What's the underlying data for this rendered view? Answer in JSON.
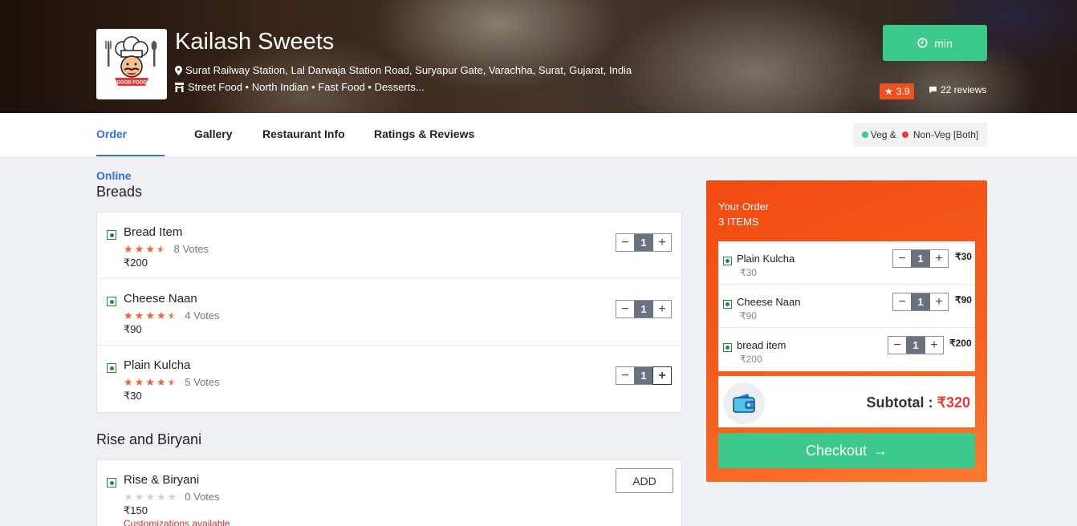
{
  "restaurant": {
    "name": "Kailash Sweets",
    "address": "Surat Railway Station, Lal Darwaja Station Road, Suryapur Gate, Varachha, Surat, Gujarat, India",
    "cuisines": "Street Food • North Indian • Fast Food • Desserts...",
    "time_label": "min",
    "rating": "3.9",
    "reviews": "22 reviews",
    "logo_text": "GOOD FOOD"
  },
  "tabs": [
    {
      "label": "Order Online",
      "active": true
    },
    {
      "label": "Gallery",
      "active": false
    },
    {
      "label": "Restaurant Info",
      "active": false
    },
    {
      "label": "Ratings & Reviews",
      "active": false
    }
  ],
  "veg_filter": {
    "veg": "Veg &",
    "nonveg": "Non-Veg [Both]",
    "veg_color": "#3cc98c",
    "nonveg_color": "#e53935"
  },
  "sections": [
    {
      "title": "Breads",
      "items": [
        {
          "name": "Bread Item",
          "rating": 3.5,
          "votes": "8 Votes",
          "price": "₹200",
          "qty": "1"
        },
        {
          "name": "Cheese Naan",
          "rating": 4.5,
          "votes": "4 Votes",
          "price": "₹90",
          "qty": "1"
        },
        {
          "name": "Plain Kulcha",
          "rating": 4.5,
          "votes": "5 Votes",
          "price": "₹30",
          "qty": "1"
        }
      ]
    },
    {
      "title": "Rise and Biryani",
      "items": [
        {
          "name": "Rise & Biryani",
          "rating": 0,
          "votes": "0 Votes",
          "price": "₹150",
          "add_label": "ADD",
          "note": "Customizations available"
        }
      ]
    }
  ],
  "order": {
    "title": "Your Order",
    "count": "3 ITEMS",
    "items": [
      {
        "name": "Plain Kulcha",
        "price": "₹30",
        "qty": "1",
        "total": "₹30"
      },
      {
        "name": "Cheese Naan",
        "price": "₹90",
        "qty": "1",
        "total": "₹90"
      },
      {
        "name": "bread item",
        "price": "₹200",
        "qty": "1",
        "total": "₹200"
      }
    ],
    "subtotal_label": "Subtotal :",
    "subtotal_value": "₹320",
    "checkout_label": "Checkout"
  },
  "colors": {
    "accent": "#2f6fd6",
    "green": "#3cc98c",
    "orange": "#f0521f",
    "star": "#f0642c"
  }
}
